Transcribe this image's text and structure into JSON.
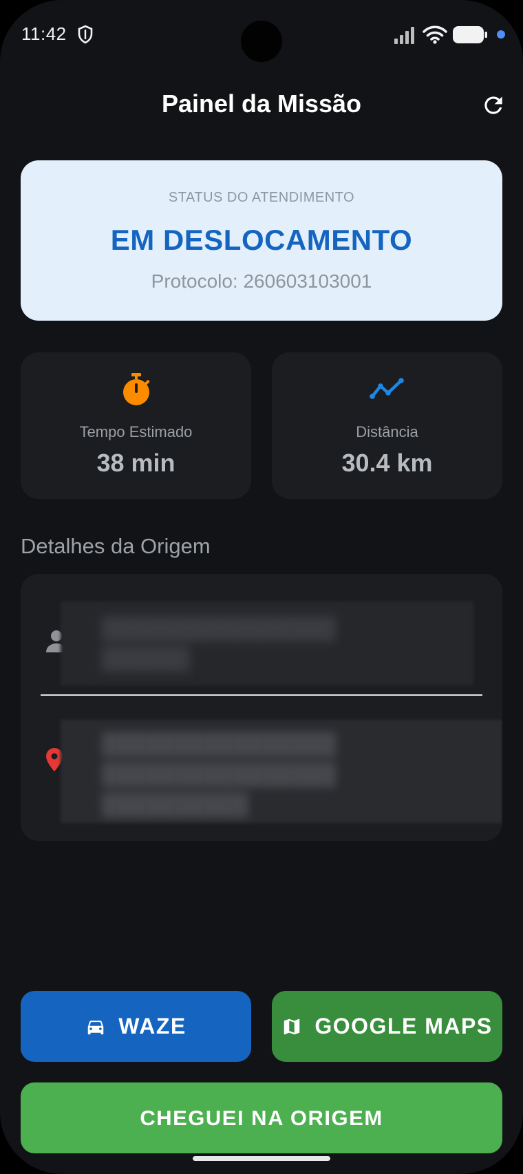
{
  "status_bar": {
    "time": "11:42",
    "icons": [
      "shield-icon",
      "signal-icon",
      "wifi-icon",
      "battery-icon"
    ]
  },
  "header": {
    "title": "Painel da Missão",
    "refresh_icon": "refresh-icon"
  },
  "status_card": {
    "kicker": "STATUS DO ATENDIMENTO",
    "value": "EM DESLOCAMENTO",
    "protocol": "Protocolo: 260603103001"
  },
  "stats": {
    "time": {
      "label": "Tempo Estimado",
      "value": "38 min",
      "icon": "stopwatch-icon"
    },
    "distance": {
      "label": "Distância",
      "value": "30.4 km",
      "icon": "trending-icon"
    }
  },
  "details": {
    "title": "Detalhes da Origem",
    "name_icon": "person-icon",
    "address_icon": "location-pin-icon"
  },
  "buttons": {
    "waze": "WAZE",
    "google_maps": "GOOGLE MAPS",
    "arrived": "CHEGUEI NA ORIGEM"
  },
  "colors": {
    "background": "#121316",
    "card": "#1c1d21",
    "status_card": "#e3f0fc",
    "status_text": "#1565c0",
    "waze": "#1565c0",
    "google_maps": "#388e3c",
    "arrived": "#4caf50",
    "timer_icon": "#fb8c00",
    "distance_icon": "#1e88e5",
    "pin_icon": "#e53935"
  }
}
